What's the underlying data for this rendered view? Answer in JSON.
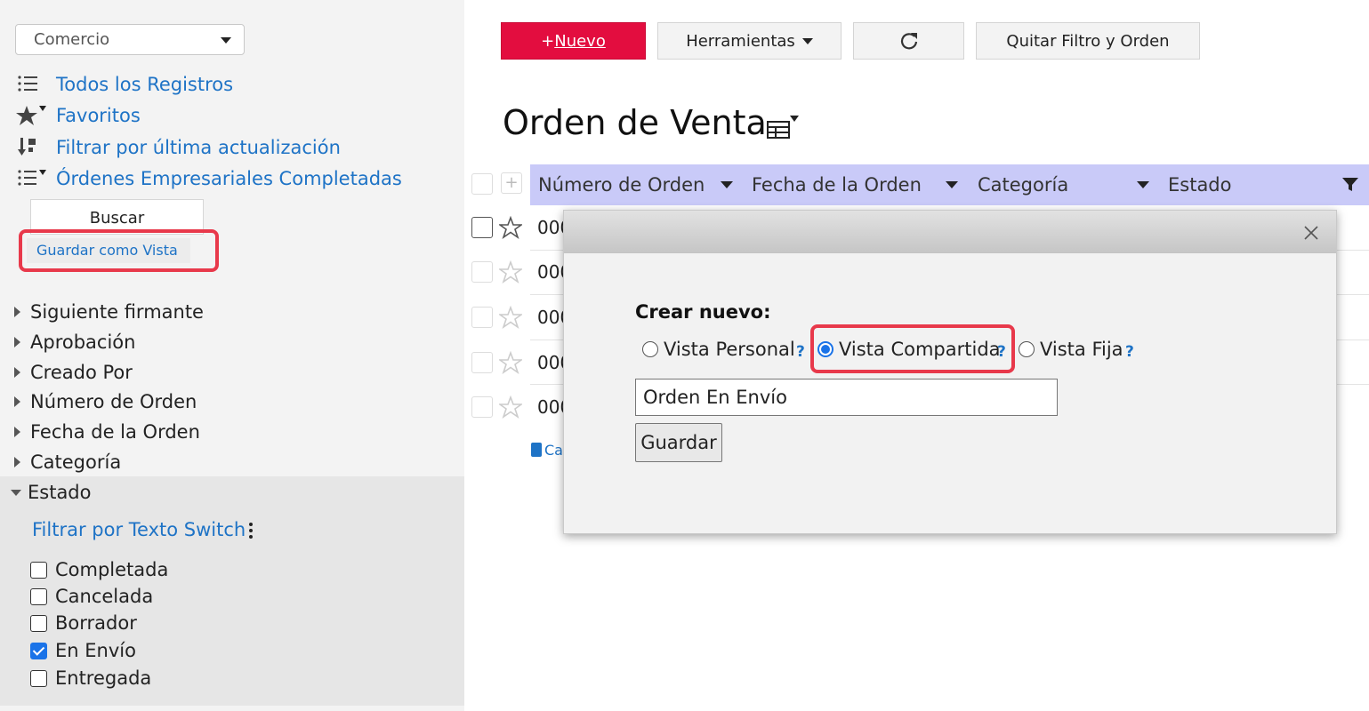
{
  "sidebar": {
    "app_select": "Comercio",
    "nav": [
      {
        "label": "Todos los Registros",
        "icon": "list-icon"
      },
      {
        "label": "Favoritos",
        "icon": "star-filter-icon"
      },
      {
        "label": "Filtrar por última actualización",
        "icon": "sort-icon"
      },
      {
        "label": "Órdenes Empresariales Completadas",
        "icon": "list-filter-icon"
      }
    ],
    "search_label": "Buscar",
    "save_view_label": "Guardar como Vista",
    "tree": [
      "Siguiente firmante",
      "Aprobación",
      "Creado Por",
      "Número de Orden",
      "Fecha de la Orden",
      "Categoría",
      "Estado"
    ],
    "filter_switch": "Filtrar por Texto Switch",
    "status_options": [
      {
        "label": "Completada",
        "checked": false
      },
      {
        "label": "Cancelada",
        "checked": false
      },
      {
        "label": "Borrador",
        "checked": false
      },
      {
        "label": "En Envío",
        "checked": true
      },
      {
        "label": "Entregada",
        "checked": false
      }
    ]
  },
  "toolbar": {
    "new_prefix": "+",
    "new_label": "Nuevo",
    "tools_label": "Herramientas",
    "clear_label": "Quitar Filtro y Orden"
  },
  "main": {
    "title": "Orden de Venta",
    "columns": [
      "Número de Orden",
      "Fecha de la Orden",
      "Categoría",
      "Estado"
    ],
    "row_prefix": "000",
    "calc_label": "Ca"
  },
  "dialog": {
    "create_label": "Crear nuevo:",
    "options": [
      {
        "label": "Vista Personal",
        "selected": false
      },
      {
        "label": "Vista Compartida",
        "selected": true
      },
      {
        "label": "Vista Fija",
        "selected": false
      }
    ],
    "help_mark": "?",
    "name_value": "Orden En Envío",
    "save_label": "Guardar"
  },
  "colors": {
    "accent": "#e30d3f",
    "header": "#c9caf8",
    "highlight": "#e8394b",
    "link": "#1e73c6"
  }
}
